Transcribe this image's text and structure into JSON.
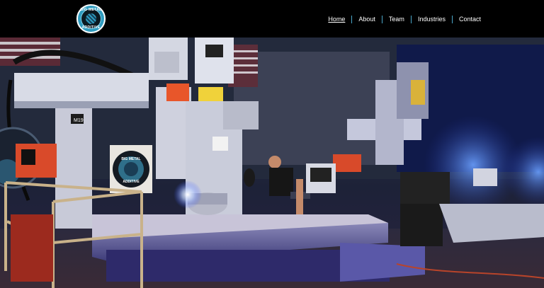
{
  "logo": {
    "line1": "BIG METAL",
    "line2": "ADDITIVE",
    "icon": "company-logo"
  },
  "nav": {
    "items": [
      {
        "label": "Home",
        "active": true
      },
      {
        "label": "About",
        "active": false
      },
      {
        "label": "Team",
        "active": false
      },
      {
        "label": "Industries",
        "active": false
      },
      {
        "label": "Contact",
        "active": false
      }
    ]
  },
  "hero": {
    "sign_line1": "BIG METAL",
    "sign_line2": "ADDITIVE",
    "machine_tag": "M19",
    "colors": {
      "accent_blue": "#2f9cc0",
      "nav_separator": "#4aa6c8",
      "glow_blue": "#3b6bff",
      "machine_orange": "#e8562a"
    }
  }
}
